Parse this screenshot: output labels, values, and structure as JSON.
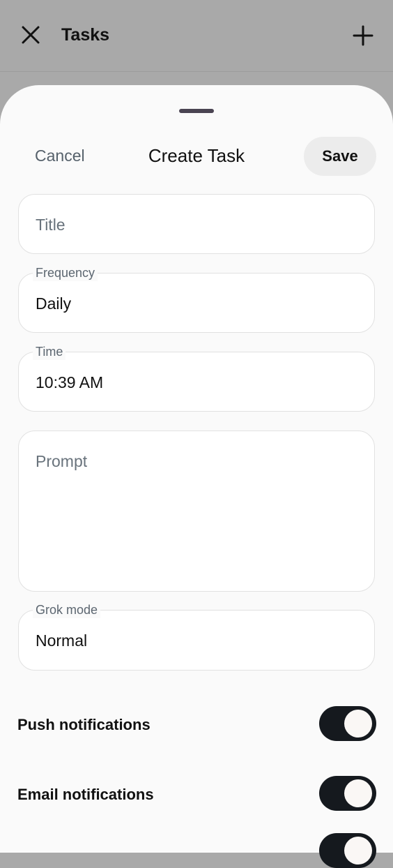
{
  "appbar": {
    "title": "Tasks",
    "close_icon": "close-icon",
    "add_icon": "plus-icon"
  },
  "sheet": {
    "cancel_label": "Cancel",
    "title": "Create Task",
    "save_label": "Save",
    "fields": {
      "title": {
        "placeholder": "Title",
        "value": ""
      },
      "frequency": {
        "label": "Frequency",
        "value": "Daily"
      },
      "time": {
        "label": "Time",
        "value": "10:39 AM"
      },
      "prompt": {
        "placeholder": "Prompt",
        "value": ""
      },
      "grok_mode": {
        "label": "Grok mode",
        "value": "Normal"
      }
    },
    "toggles": [
      {
        "label": "Push notifications",
        "on": true
      },
      {
        "label": "Email notifications",
        "on": true
      }
    ]
  },
  "colors": {
    "scrim": "#a9a9a9",
    "sheet_bg": "#fafafa",
    "toggle_on": "#15191e",
    "handle": "#4a4452"
  }
}
